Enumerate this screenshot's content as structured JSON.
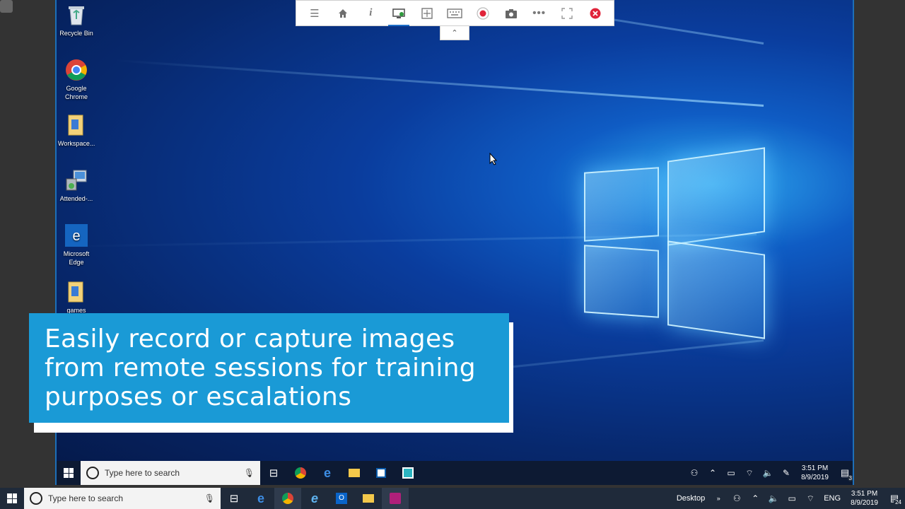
{
  "colors": {
    "caption_bg": "#1a9ad6",
    "toolbar_active": "#1e6fc8",
    "close_red": "#e0243a",
    "record_red": "#e0243a"
  },
  "toolbar": {
    "buttons": [
      {
        "icon": "menu-icon"
      },
      {
        "icon": "home-icon"
      },
      {
        "icon": "info-icon"
      },
      {
        "icon": "monitor-icon",
        "active": true
      },
      {
        "icon": "fit-screen-icon"
      },
      {
        "icon": "keyboard-icon"
      },
      {
        "icon": "record-icon"
      },
      {
        "icon": "camera-icon"
      },
      {
        "icon": "more-icon"
      },
      {
        "icon": "fullscreen-icon"
      },
      {
        "icon": "close-icon"
      }
    ]
  },
  "desktop_icons": [
    {
      "label": "Recycle Bin",
      "icon": "recycle-bin-icon"
    },
    {
      "label": "Google Chrome",
      "icon": "chrome-icon"
    },
    {
      "label": "Workspace...",
      "icon": "folder-icon"
    },
    {
      "label": "Attended-...",
      "icon": "installer-icon"
    },
    {
      "label": "Microsoft Edge",
      "icon": "edge-icon"
    },
    {
      "label": "games",
      "icon": "folder-icon"
    }
  ],
  "caption": {
    "line1": "Easily record or capture images",
    "line2": "from remote sessions for training",
    "line3": "purposes or escalations"
  },
  "remote_taskbar": {
    "search_placeholder": "Type here to search",
    "time": "3:51 PM",
    "date": "8/9/2019",
    "notification_count": "3"
  },
  "host_taskbar": {
    "search_placeholder": "Type here to search",
    "desktop_label": "Desktop",
    "language": "ENG",
    "time": "3:51 PM",
    "date": "8/9/2019",
    "notification_count": "24"
  }
}
